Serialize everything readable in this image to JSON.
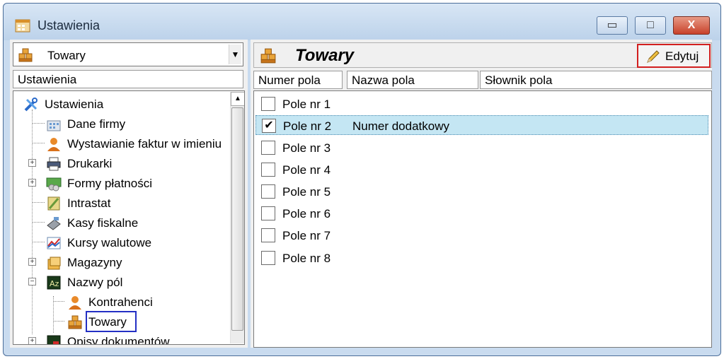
{
  "window": {
    "title": "Ustawienia"
  },
  "left": {
    "combo_value": "Towary",
    "header": "Ustawienia",
    "tree": [
      {
        "label": "Ustawienia",
        "icon": "tools-icon"
      },
      {
        "label": "Dane firmy",
        "icon": "building-icon"
      },
      {
        "label": "Wystawianie faktur w imieniu",
        "icon": "person-icon"
      },
      {
        "label": "Drukarki",
        "icon": "printer-icon"
      },
      {
        "label": "Formy płatności",
        "icon": "payment-icon"
      },
      {
        "label": "Intrastat",
        "icon": "intrastat-icon"
      },
      {
        "label": "Kasy fiskalne",
        "icon": "cash-register-icon"
      },
      {
        "label": "Kursy walutowe",
        "icon": "chart-icon"
      },
      {
        "label": "Magazyny",
        "icon": "warehouse-icon"
      },
      {
        "label": "Nazwy pól",
        "icon": "field-names-icon"
      },
      {
        "label": "Kontrahenci",
        "icon": "person-icon"
      },
      {
        "label": "Towary",
        "icon": "boxes-icon"
      },
      {
        "label": "Opisy dokumentów",
        "icon": "field-names-icon"
      }
    ]
  },
  "right": {
    "title": "Towary",
    "edit_label": "Edytuj",
    "columns": [
      "Numer pola",
      "Nazwa pola",
      "Słownik pola"
    ],
    "rows": [
      {
        "label": "Pole nr  1",
        "name": "",
        "checked": false
      },
      {
        "label": "Pole nr  2",
        "name": "Numer dodatkowy",
        "checked": true
      },
      {
        "label": "Pole nr  3",
        "name": "",
        "checked": false
      },
      {
        "label": "Pole nr  4",
        "name": "",
        "checked": false
      },
      {
        "label": "Pole nr  5",
        "name": "",
        "checked": false
      },
      {
        "label": "Pole nr  6",
        "name": "",
        "checked": false
      },
      {
        "label": "Pole nr  7",
        "name": "",
        "checked": false
      },
      {
        "label": "Pole nr  8",
        "name": "",
        "checked": false
      }
    ],
    "check_mark": "✔"
  },
  "window_buttons": {
    "minimize": "▭",
    "maximize": "□",
    "close": "X"
  }
}
